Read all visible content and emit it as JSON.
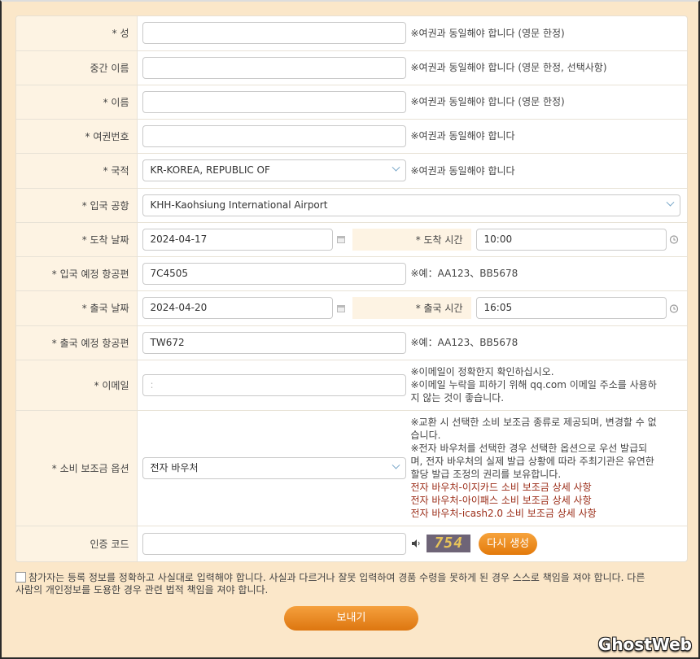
{
  "form": {
    "rows": {
      "surname": {
        "label": "* 성",
        "value": "",
        "note": "※여권과 동일해야 합니다 (영문 한정)"
      },
      "middle_name": {
        "label": "중간 이름",
        "value": "",
        "note": "※여권과 동일해야 합니다 (영문 한정, 선택사항)"
      },
      "given_name": {
        "label": "* 이름",
        "value": "",
        "note": "※여권과 동일해야 합니다 (영문 한정)"
      },
      "passport_no": {
        "label": "* 여권번호",
        "value": "",
        "note": "※여권과 동일해야 합니다"
      },
      "nationality": {
        "label": "* 국적",
        "value": "KR-KOREA, REPUBLIC OF",
        "note": "※여권과 동일해야 합니다"
      },
      "entry_airport": {
        "label": "* 입국 공항",
        "value": "KHH-Kaohsiung International Airport"
      },
      "arrival": {
        "date_label": "* 도착 날짜",
        "date": "2024-04-17",
        "time_label": "* 도착 시간",
        "time": "10:00"
      },
      "arrival_flight": {
        "label": "* 입국 예정 항공편",
        "value": "7C4505",
        "note": "※예：AA123、BB5678"
      },
      "departure": {
        "date_label": "* 출국 날짜",
        "date": "2024-04-20",
        "time_label": "* 출국 시간",
        "time": "16:05"
      },
      "departure_flight": {
        "label": "* 출국 예정 항공편",
        "value": "TW672",
        "note": "※예：AA123、BB5678"
      },
      "email": {
        "label": "* 이메일",
        "value": ":",
        "note_1": "※이메일이 정확한지 확인하십시오.",
        "note_2": "※이메일 누락을 피하기 위해 qq.com 이메일 주소를 사용하",
        "note_3": "지 않는 것이 좋습니다."
      },
      "voucher": {
        "label": "* 소비 보조금 옵션",
        "value": "전자 바우처",
        "note_1": "※교환 시 선택한 소비 보조금 종류로 제공되며, 변경할 수 없",
        "note_2": "습니다.",
        "note_3": "※전자 바우처를 선택한 경우 선택한 옵션으로 우선 발급되",
        "note_4": "며, 전자 바우처의 실제 발급 상황에 따라 주최기관은 유연한",
        "note_5": "할당 발급 조정의 권리를 보유합니다.",
        "links": [
          "전자 바우처-이지카드 소비 보조금 상세 사항",
          "전자 바우처-아이패스 소비 보조금 상세 사항",
          "전자 바우처-icash2.0 소비 보조금 상세 사항"
        ]
      },
      "captcha": {
        "label": "인증 코드",
        "value": "",
        "captcha_text": "754",
        "regen_label": "다시 생성"
      }
    }
  },
  "agreement": {
    "line_1": "참가자는 등록 정보를 정확하고 사실대로 입력해야 합니다. 사실과 다르거나 잘못 입력하여 경품 수령을 못하게 된 경우 스스로 책임을 져야 합니다. 다른",
    "line_2": "사람의 개인정보를 도용한 경우 관련 법적 책임을 져야 합니다."
  },
  "submit_label": "보내기",
  "watermark": "GhostWeb",
  "colors": {
    "accent": "#e37a0b",
    "label_bg": "#fdf3e3",
    "link": "#9b2d18",
    "page_bg": "#fbe7c9"
  }
}
